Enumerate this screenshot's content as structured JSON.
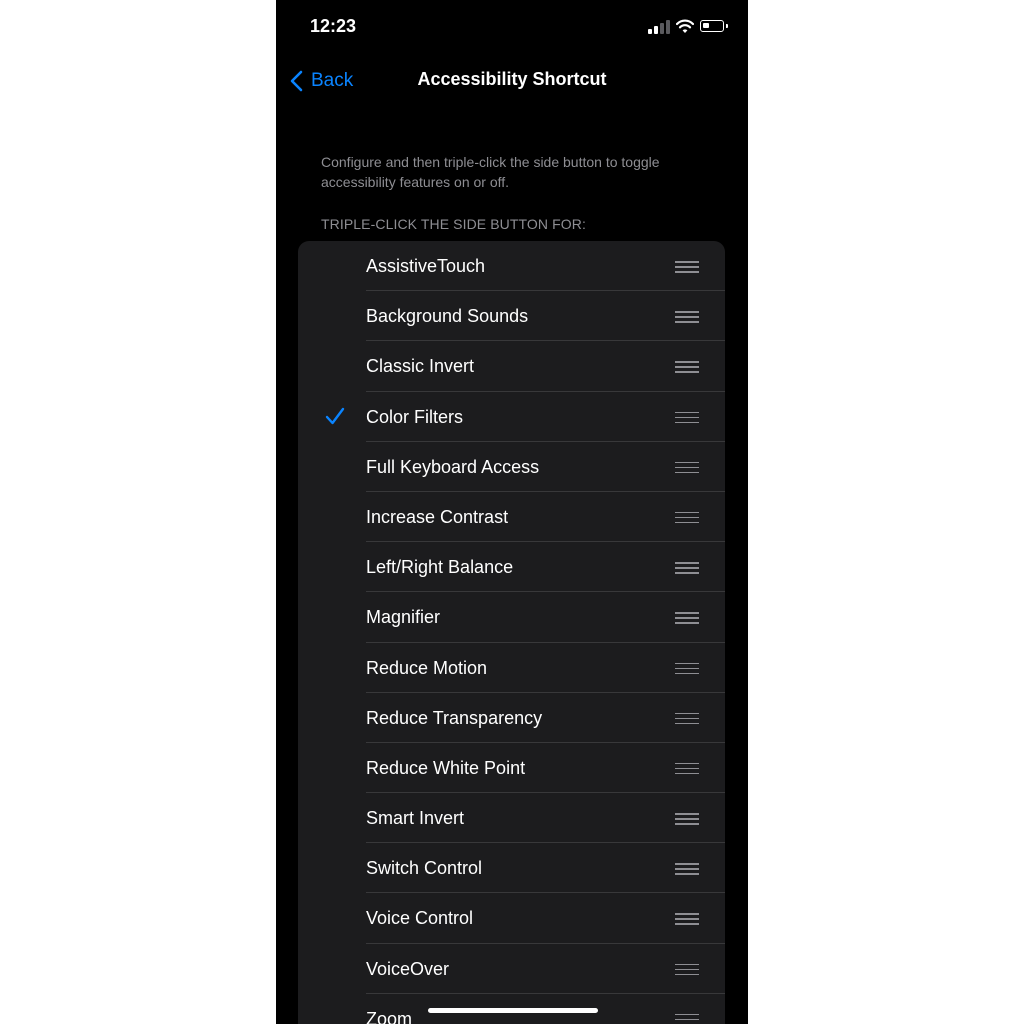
{
  "status_bar": {
    "time": "12:23"
  },
  "nav": {
    "back_label": "Back",
    "title": "Accessibility Shortcut"
  },
  "description": "Configure and then triple-click the side button to toggle accessibility features on or off.",
  "section_header": "TRIPLE-CLICK THE SIDE BUTTON FOR:",
  "accent_color": "#0a84ff",
  "items": [
    {
      "label": "AssistiveTouch",
      "checked": false
    },
    {
      "label": "Background Sounds",
      "checked": false
    },
    {
      "label": "Classic Invert",
      "checked": false
    },
    {
      "label": "Color Filters",
      "checked": true
    },
    {
      "label": "Full Keyboard Access",
      "checked": false
    },
    {
      "label": "Increase Contrast",
      "checked": false
    },
    {
      "label": "Left/Right Balance",
      "checked": false
    },
    {
      "label": "Magnifier",
      "checked": false
    },
    {
      "label": "Reduce Motion",
      "checked": false
    },
    {
      "label": "Reduce Transparency",
      "checked": false
    },
    {
      "label": "Reduce White Point",
      "checked": false
    },
    {
      "label": "Smart Invert",
      "checked": false
    },
    {
      "label": "Switch Control",
      "checked": false
    },
    {
      "label": "Voice Control",
      "checked": false
    },
    {
      "label": "VoiceOver",
      "checked": false
    },
    {
      "label": "Zoom",
      "checked": false
    }
  ]
}
